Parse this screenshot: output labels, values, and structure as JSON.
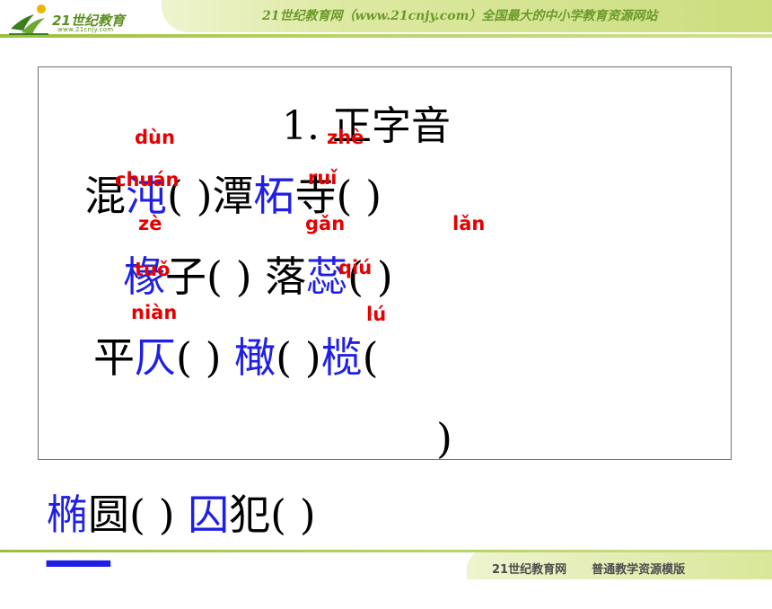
{
  "header": {
    "logo_text": "21世纪教育",
    "logo_sub": "www.21cnjy.com",
    "site_title": "21世纪教育网（www.21cnjy.com）全国最大的中小学教育资源网站"
  },
  "slide": {
    "title": "1. 正字音",
    "rows": [
      {
        "id": "r1",
        "parts": [
          {
            "text": "混",
            "color": "black"
          },
          {
            "text": "沌",
            "color": "blue"
          },
          {
            "text": "(           )",
            "color": "black"
          },
          {
            "text": "潭",
            "color": "black"
          },
          {
            "text": "柘",
            "color": "blue"
          },
          {
            "text": "寺(        )",
            "color": "black"
          }
        ]
      },
      {
        "id": "r2",
        "parts": [
          {
            "text": "椽",
            "color": "blue"
          },
          {
            "text": "子(       ) 落",
            "color": "black"
          },
          {
            "text": "蕊",
            "color": "blue"
          },
          {
            "text": "(         )",
            "color": "black"
          }
        ]
      },
      {
        "id": "r3",
        "parts": [
          {
            "text": "平",
            "color": "black"
          },
          {
            "text": "仄",
            "color": "blue"
          },
          {
            "text": "(           ) ",
            "color": "black"
          },
          {
            "text": "橄",
            "color": "blue"
          },
          {
            "text": "(          )",
            "color": "black"
          },
          {
            "text": "榄",
            "color": "blue"
          },
          {
            "text": "(",
            "color": "black"
          }
        ]
      },
      {
        "id": "r3b",
        "parts": [
          {
            "text": ")",
            "color": "black"
          }
        ]
      },
      {
        "id": "r4",
        "parts": [
          {
            "text": "椭",
            "color": "blue"
          },
          {
            "text": "圆(           ) ",
            "color": "black"
          },
          {
            "text": "囚",
            "color": "blue"
          },
          {
            "text": "犯(                )",
            "color": "black"
          }
        ]
      }
    ],
    "pinyin": [
      "dùn",
      "zhè",
      "chuán",
      "ruǐ",
      "zè",
      "gǎn",
      "lǎn",
      "tuǒ",
      "qiú",
      "niàn",
      "lú"
    ]
  },
  "footer": {
    "left_text": "21世纪教育网",
    "right_text": "普通教学资源模版"
  },
  "colors": {
    "blue_char": "#1f1fe6",
    "pinyin": "#e60000",
    "header_green": "#6b9a2a"
  }
}
